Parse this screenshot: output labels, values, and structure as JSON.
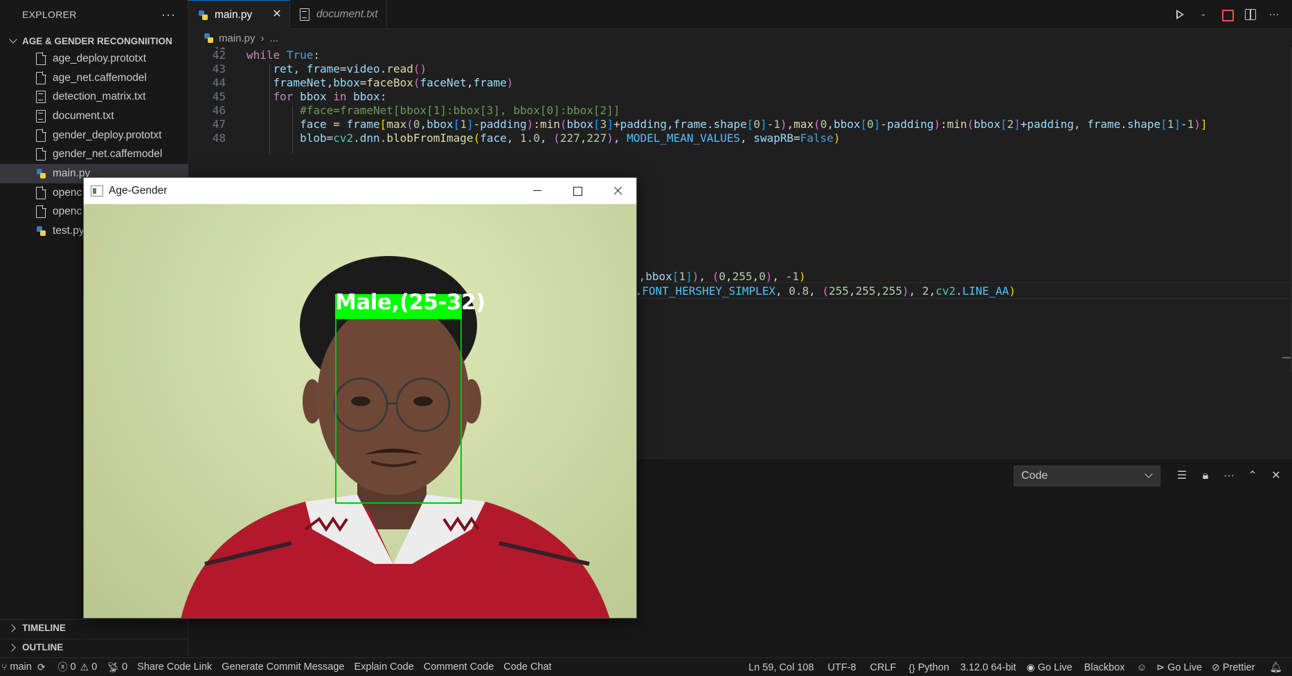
{
  "sidebar": {
    "title": "EXPLORER",
    "folder": "AGE & GENDER RECONGNIITION",
    "files": [
      {
        "name": "age_deploy.prototxt",
        "icon": "file-icon"
      },
      {
        "name": "age_net.caffemodel",
        "icon": "file-icon"
      },
      {
        "name": "detection_matrix.txt",
        "icon": "text-file-icon"
      },
      {
        "name": "document.txt",
        "icon": "text-file-icon"
      },
      {
        "name": "gender_deploy.prototxt",
        "icon": "file-icon"
      },
      {
        "name": "gender_net.caffemodel",
        "icon": "file-icon"
      },
      {
        "name": "main.py",
        "icon": "python-icon",
        "active": true
      },
      {
        "name": "openc",
        "icon": "file-icon"
      },
      {
        "name": "openc",
        "icon": "file-icon"
      },
      {
        "name": "test.py",
        "icon": "python-icon"
      }
    ],
    "timeline": "TIMELINE",
    "outline": "OUTLINE"
  },
  "tabs": [
    {
      "label": "main.py",
      "active": true
    },
    {
      "label": "document.txt",
      "active": false
    }
  ],
  "breadcrumb": {
    "file": "main.py",
    "more": "..."
  },
  "code": {
    "top_partial_line_number": "41",
    "lines": [
      {
        "n": "42"
      },
      {
        "n": "43"
      },
      {
        "n": "44"
      },
      {
        "n": "45"
      },
      {
        "n": "46"
      },
      {
        "n": "47"
      },
      {
        "n": "48"
      }
    ],
    "visible_right_fragments": [
      "],bbox[1]), (0,255,0), -1)",
      "2.FONT_HERSHEY_SIMPLEX, 0.8, (255,255,255), 2,cv2.LINE_AA)"
    ]
  },
  "panel": {
    "selected_output": "Code"
  },
  "floating_window": {
    "title": "Age-Gender",
    "detection_label": "Male,(25-32)"
  },
  "statusbar": {
    "branch": "main",
    "errors": "0",
    "warnings": "0",
    "ports": "0",
    "items": [
      "Share Code Link",
      "Generate Commit Message",
      "Explain Code",
      "Comment Code",
      "Code Chat"
    ],
    "cursor": "Ln 59, Col 108",
    "encoding": "UTF-8",
    "eol": "CRLF",
    "language": "Python",
    "interpreter": "3.12.0 64-bit",
    "golive1": "Go Live",
    "blackbox": "Blackbox",
    "golive2": "Go Live",
    "prettier": "Prettier"
  },
  "colors": {
    "accent": "#0078d4",
    "detection_box": "#00ff00",
    "stop": "#f14c4c"
  }
}
